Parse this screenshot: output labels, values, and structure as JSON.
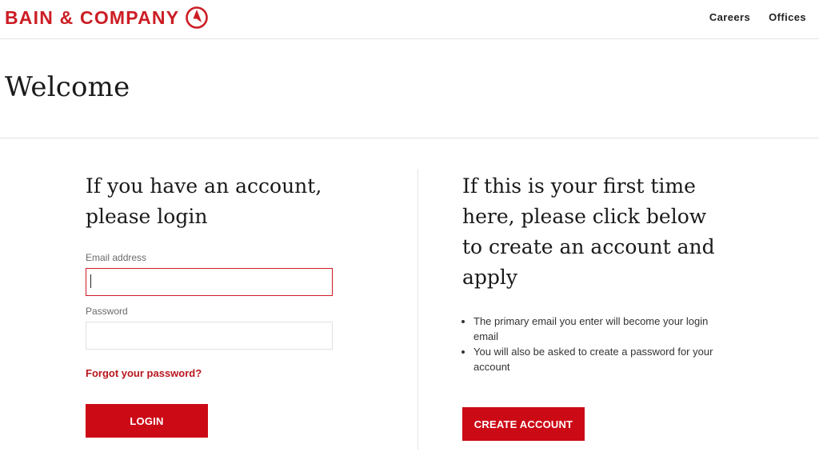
{
  "header": {
    "brand": "BAIN & COMPANY",
    "nav": [
      {
        "label": "Careers"
      },
      {
        "label": "Offices"
      }
    ],
    "brand_color": "#cc1d24"
  },
  "welcome": {
    "title": "Welcome"
  },
  "login": {
    "heading": "If you have an account, please login",
    "email_label": "Email address",
    "email_value": "",
    "password_label": "Password",
    "password_value": "",
    "forgot_link": "Forgot your password?",
    "login_button": "LOGIN"
  },
  "create": {
    "heading": "If this is your first time here, please click below to create an account and apply",
    "bullets": [
      "The primary email you enter will become your login email",
      "You will also be asked to create a password for your account"
    ],
    "create_button": "CREATE ACCOUNT"
  },
  "icons": {
    "logo_mark": "compass-icon"
  },
  "colors": {
    "accent": "#cc0a16",
    "focus_border": "#cc1d24",
    "link": "#b8161e"
  }
}
